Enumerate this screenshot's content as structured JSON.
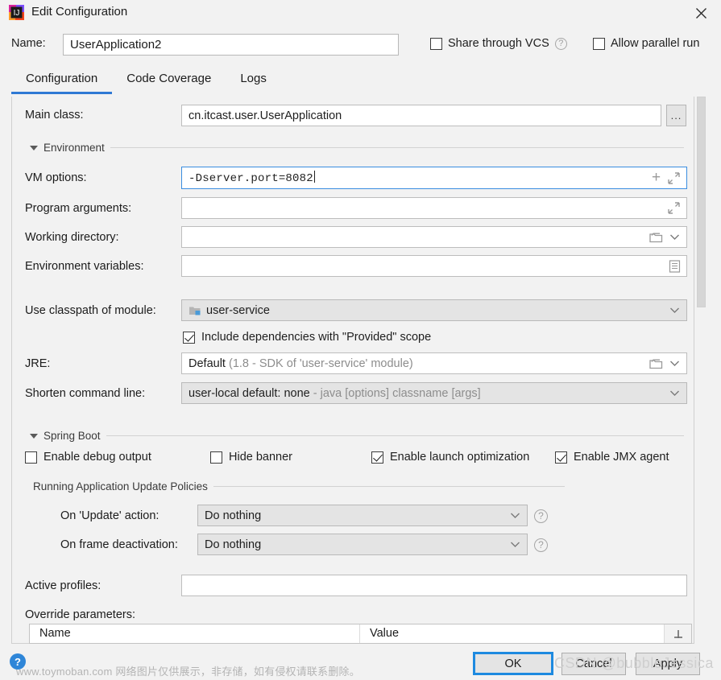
{
  "window": {
    "title": "Edit Configuration",
    "app_icon": "intellij-idea-icon",
    "close_icon": "✕"
  },
  "name_row": {
    "label": "Name:",
    "value": "UserApplication2",
    "placeholder": "",
    "share_vcs_label": "Share through VCS",
    "share_vcs_checked": false,
    "share_vcs_help": "?",
    "allow_parallel_label": "Allow parallel run",
    "allow_parallel_checked": false
  },
  "tabs": [
    {
      "label": "Configuration",
      "active": true
    },
    {
      "label": "Code Coverage",
      "active": false
    },
    {
      "label": "Logs",
      "active": false
    }
  ],
  "form": {
    "main_class": {
      "label": "Main class:",
      "value": "cn.itcast.user.UserApplication",
      "browse_label": "..."
    },
    "environment_section": "Environment",
    "vm_options": {
      "label": "VM options:",
      "value": "-Dserver.port=8082",
      "focused": true
    },
    "program_arguments": {
      "label": "Program arguments:",
      "value": ""
    },
    "working_directory": {
      "label": "Working directory:",
      "value": ""
    },
    "environment_variables": {
      "label": "Environment variables:",
      "value": ""
    },
    "classpath_module": {
      "label": "Use classpath of module:",
      "value": "user-service"
    },
    "include_dependencies": {
      "label": "Include dependencies with \"Provided\" scope",
      "checked": true
    },
    "jre": {
      "label": "JRE:",
      "value": "Default",
      "value_hint": "(1.8 - SDK of 'user-service' module)"
    },
    "shorten_command_line": {
      "label": "Shorten command line:",
      "value": "user-local default: none",
      "value_hint": "- java [options] classname [args]"
    }
  },
  "spring_boot": {
    "section": "Spring Boot",
    "checks": [
      {
        "label": "Enable debug output",
        "checked": false
      },
      {
        "label": "Hide banner",
        "checked": false
      },
      {
        "label": "Enable launch optimization",
        "checked": true
      },
      {
        "label": "Enable JMX agent",
        "checked": true
      }
    ],
    "policies_section": "Running Application Update Policies",
    "on_update": {
      "label": "On 'Update' action:",
      "value": "Do nothing",
      "help": "?"
    },
    "on_frame_deactivation": {
      "label": "On frame deactivation:",
      "value": "Do nothing",
      "help": "?"
    },
    "active_profiles": {
      "label": "Active profiles:",
      "value": ""
    },
    "override_parameters": {
      "label": "Override parameters:",
      "columns": [
        "Name",
        "Value"
      ],
      "rows": []
    }
  },
  "footer": {
    "help_label": "?",
    "ok_label": "OK",
    "cancel_label": "Cancel",
    "apply_label": "Apply"
  },
  "watermarks": {
    "cn": "www.toymoban.com 网络图片仅供展示，非存储，如有侵权请联系删除。",
    "csdn": "CSDN @bubbleJessica"
  },
  "colors": {
    "accent": "#2f79d4",
    "focus_border": "#3a8de0",
    "panel_bg": "#f2f2f2",
    "field_bg": "#ffffff",
    "combo_bg": "#e4e4e4"
  }
}
